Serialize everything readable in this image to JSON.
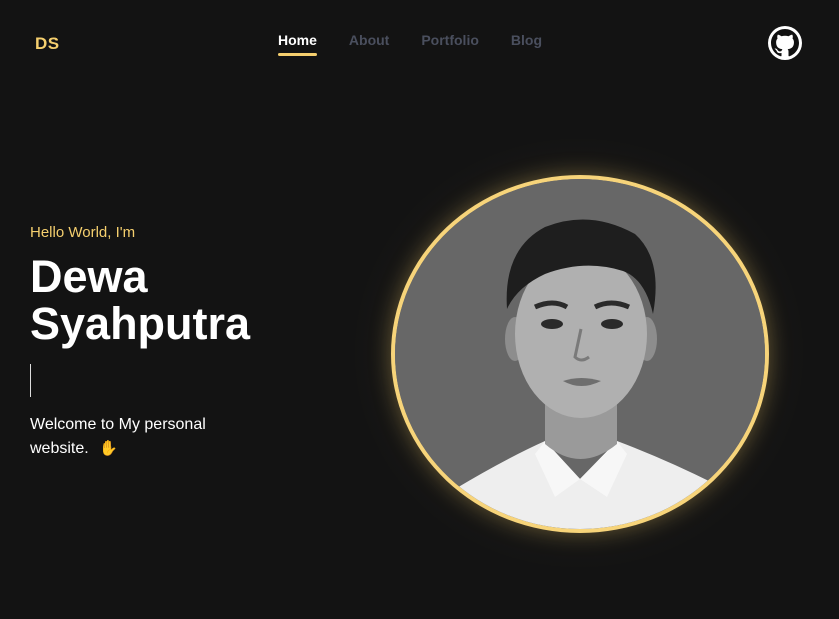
{
  "brand": {
    "logo_text": "DS",
    "accent_color": "#f5cf6e"
  },
  "nav": {
    "items": [
      {
        "label": "Home",
        "active": true
      },
      {
        "label": "About",
        "active": false
      },
      {
        "label": "Portfolio",
        "active": false
      },
      {
        "label": "Blog",
        "active": false
      }
    ],
    "github_icon": "github-icon"
  },
  "hero": {
    "greeting": "Hello World, I'm",
    "name_line1": "Dewa",
    "name_line2": "Syahputra",
    "welcome": "Welcome to My personal website.",
    "wave_icon": "waving-hand-icon",
    "photo_icon": "profile-photo"
  },
  "colors": {
    "background": "#131313",
    "inactive_nav": "#4a4f5e",
    "portrait_border": "#f7d47a"
  }
}
